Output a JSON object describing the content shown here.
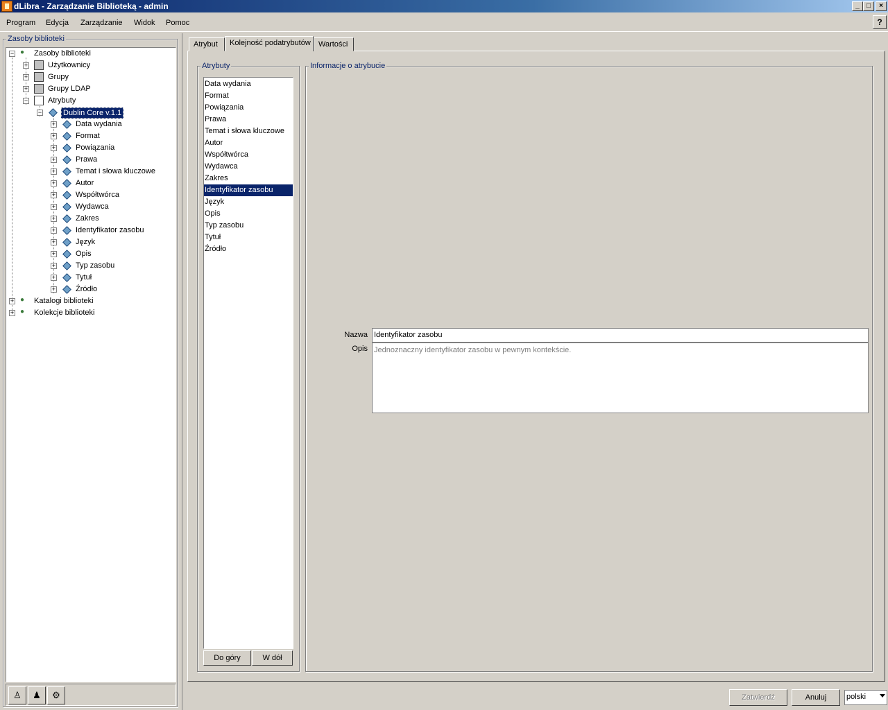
{
  "window": {
    "title": "dLibra - Zarządzanie Biblioteką - admin",
    "minimize": "_",
    "maximize": "□",
    "close": "×"
  },
  "menu": [
    "Program",
    "Edycja",
    "Zarządzanie",
    "Widok",
    "Pomoc"
  ],
  "help_button": "?",
  "left_panel": {
    "title": "Zasoby biblioteki",
    "tree": {
      "root": "Zasoby biblioteki",
      "users": "Użytkownicy",
      "groups": "Grupy",
      "ldap_groups": "Grupy LDAP",
      "attributes": "Atrybuty",
      "schema": "Dublin Core v.1.1",
      "schema_children": [
        "Data wydania",
        "Format",
        "Powiązania",
        "Prawa",
        "Temat i słowa kluczowe",
        "Autor",
        "Współtwórca",
        "Wydawca",
        "Zakres",
        "Identyfikator zasobu",
        "Język",
        "Opis",
        "Typ zasobu",
        "Tytuł",
        "Źródło"
      ],
      "catalogs": "Katalogi biblioteki",
      "collections": "Kolekcje biblioteki"
    }
  },
  "tabs": [
    "Atrybut",
    "Kolejność podatrybutów",
    "Wartości"
  ],
  "active_tab": "Kolejność podatrybutów",
  "attributes_group": {
    "title": "Atrybuty",
    "items": [
      "Data wydania",
      "Format",
      "Powiązania",
      "Prawa",
      "Temat i słowa kluczowe",
      "Autor",
      "Współtwórca",
      "Wydawca",
      "Zakres",
      "Identyfikator zasobu",
      "Język",
      "Opis",
      "Typ zasobu",
      "Tytuł",
      "Źródło"
    ],
    "selected": "Identyfikator zasobu",
    "up_button": "Do góry",
    "down_button": "W dół"
  },
  "info_group": {
    "title": "Informacje o atrybucie",
    "name_label": "Nazwa",
    "name_value": "Identyfikator zasobu",
    "desc_label": "Opis",
    "desc_value": "Jednoznaczny identyfikator zasobu w pewnym kontekście."
  },
  "footer": {
    "confirm": "Zatwierdź",
    "cancel": "Anuluj",
    "language": "polski"
  }
}
